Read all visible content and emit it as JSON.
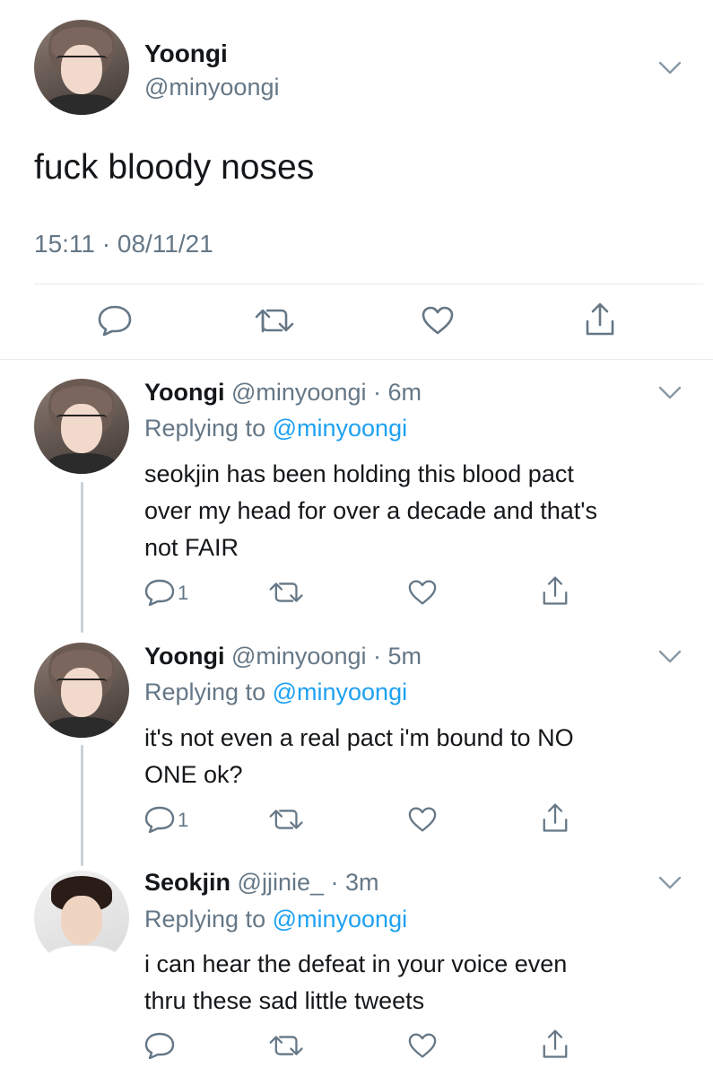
{
  "main_tweet": {
    "display_name": "Yoongi",
    "handle": "@minyoongi",
    "text": "fuck bloody noses",
    "timestamp": "15:11 · 08/11/21"
  },
  "replies": [
    {
      "display_name": "Yoongi",
      "handle": "@minyoongi",
      "time": "· 6m",
      "replying_prefix": "Replying to",
      "replying_handle": "@minyoongi",
      "text_lines": [
        "seokjin has been holding this blood pact",
        "over my head for over a decade and that's",
        "not FAIR"
      ],
      "reply_count": "1"
    },
    {
      "display_name": "Yoongi",
      "handle": "@minyoongi",
      "time": "· 5m",
      "replying_prefix": "Replying to",
      "replying_handle": "@minyoongi",
      "text_lines": [
        "it's not even a real pact i'm bound to NO",
        "ONE ok?"
      ],
      "reply_count": "1"
    },
    {
      "display_name": "Seokjin",
      "handle": "@jjinie_",
      "time": "· 3m",
      "replying_prefix": "Replying to",
      "replying_handle": "@minyoongi",
      "text_lines": [
        "i can hear the defeat in your voice even",
        "thru these sad little tweets"
      ],
      "reply_count": ""
    }
  ],
  "icons": {
    "reply": "reply-icon",
    "retweet": "retweet-icon",
    "like": "like-icon",
    "share": "share-icon",
    "more": "chevron-down-icon"
  },
  "colors": {
    "text": "#14171a",
    "muted": "#657786",
    "link": "#1da1f2",
    "thread_line": "#c9d1d8",
    "divider": "#e6ecf0"
  }
}
